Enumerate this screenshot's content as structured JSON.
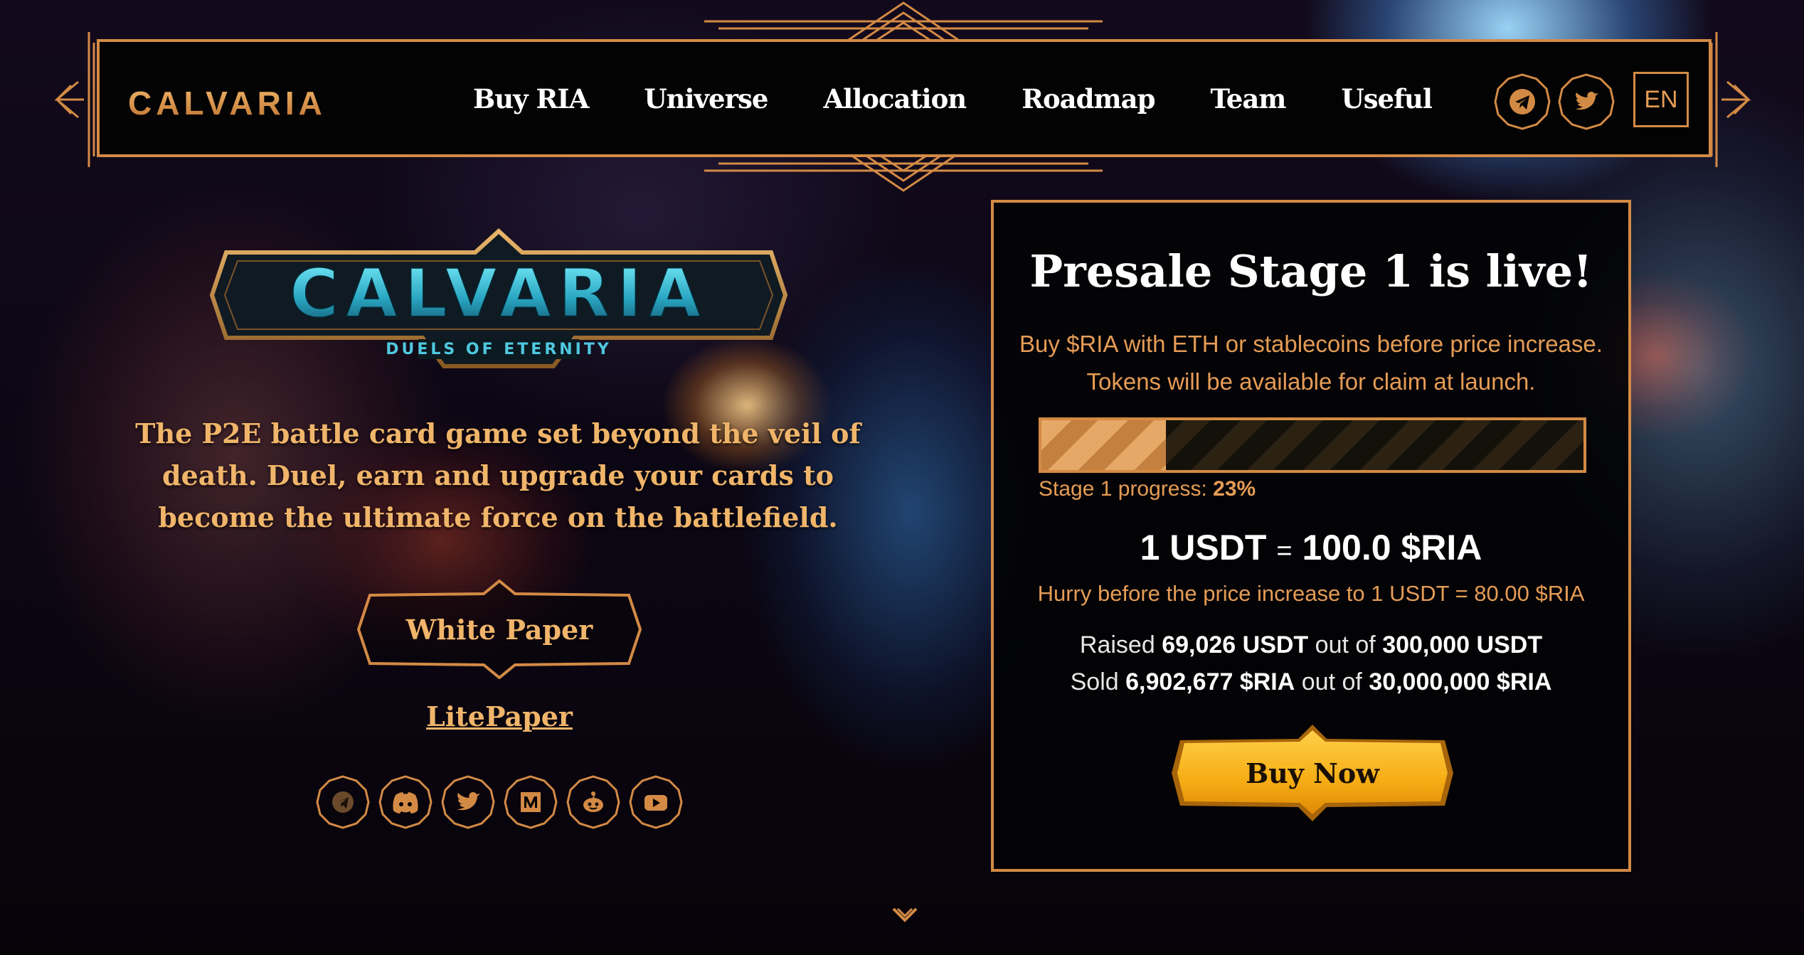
{
  "header": {
    "logo_text": "CALVARIA",
    "nav": [
      "Buy RIA",
      "Universe",
      "Allocation",
      "Roadmap",
      "Team",
      "Useful"
    ],
    "social_icons": [
      "telegram-icon",
      "twitter-icon"
    ],
    "language": "EN"
  },
  "hero": {
    "game_logo_title": "CALVARIA",
    "game_logo_subtitle": "DUELS OF ETERNITY",
    "tagline": "The P2E battle card game set beyond the veil of death. Duel, earn and upgrade your cards to become the ultimate force on the battlefield.",
    "white_paper_label": "White Paper",
    "litepaper_label": "LitePaper",
    "socials": [
      "telegram-icon",
      "discord-icon",
      "twitter-icon",
      "medium-icon",
      "reddit-icon",
      "youtube-icon"
    ]
  },
  "presale": {
    "title": "Presale Stage 1 is live!",
    "subtitle_line1": "Buy $RIA with ETH or stablecoins before price increase.",
    "subtitle_line2": "Tokens will be available for claim at launch.",
    "progress_label": "Stage 1 progress:",
    "progress_percent": "23%",
    "progress_fraction": 0.23,
    "rate_left": "1 USDT",
    "rate_eq": "=",
    "rate_right": "100.0 $RIA",
    "hurry_text": "Hurry before the price increase to 1 USDT = 80.00 $RIA",
    "raised_prefix": "Raised",
    "raised_amount": "69,026 USDT",
    "raised_mid": "out of",
    "raised_total": "300,000 USDT",
    "sold_prefix": "Sold",
    "sold_amount": "6,902,677 $RIA",
    "sold_mid": "out of",
    "sold_total": "30,000,000 $RIA",
    "buy_label": "Buy Now"
  },
  "colors": {
    "accent": "#d38a45",
    "text_gold": "#e59c55",
    "button_yellow": "#f9b71c"
  }
}
